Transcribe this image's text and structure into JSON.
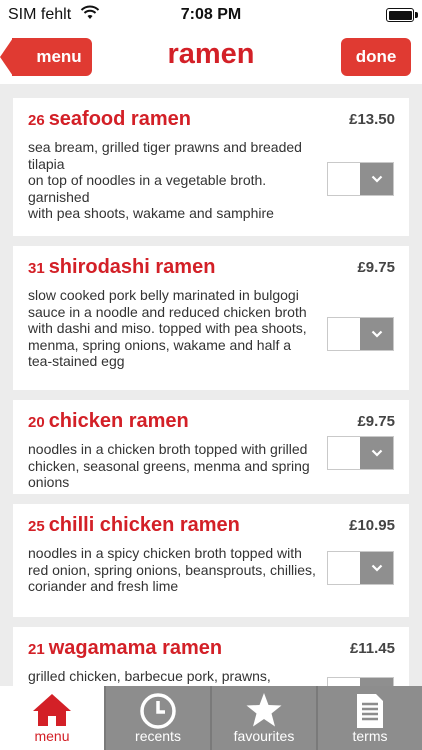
{
  "status": {
    "carrier": "SIM fehlt",
    "time": "7:08 PM"
  },
  "nav": {
    "title": "ramen",
    "back_label": "menu",
    "done_label": "done"
  },
  "items": [
    {
      "number": "26",
      "name": "seafood ramen",
      "price": "£13.50",
      "description": "sea bream, grilled tiger prawns and breaded tilapia\non top of noodles in a vegetable broth. garnished\nwith pea shoots, wakame and samphire"
    },
    {
      "number": "31",
      "name": "shirodashi ramen",
      "price": "£9.75",
      "description": "slow cooked pork belly marinated in bulgogi sauce in a noodle and reduced chicken broth with dashi and miso. topped with pea shoots, menma, spring onions, wakame and half a tea-stained egg"
    },
    {
      "number": "20",
      "name": "chicken ramen",
      "price": "£9.75",
      "description": "noodles in a chicken broth topped with grilled chicken, seasonal greens, menma and spring onions"
    },
    {
      "number": "25",
      "name": "chilli chicken ramen",
      "price": "£10.95",
      "description": "noodles in a spicy chicken broth topped with red onion, spring onions, beansprouts, chillies, coriander and fresh lime"
    },
    {
      "number": "21",
      "name": "wagamama ramen",
      "price": "£11.45",
      "description": "grilled chicken, barbecue pork, prawns, chikuwa and mussels on top of noodles"
    }
  ],
  "tabs": [
    {
      "label": "menu",
      "icon": "home-icon"
    },
    {
      "label": "recents",
      "icon": "clock-icon"
    },
    {
      "label": "favourites",
      "icon": "star-icon"
    },
    {
      "label": "terms",
      "icon": "document-icon"
    }
  ],
  "colors": {
    "brand_red": "#d32027",
    "button_red": "#e03a32",
    "tab_gray": "#8d8d8d",
    "background": "#ececec"
  }
}
